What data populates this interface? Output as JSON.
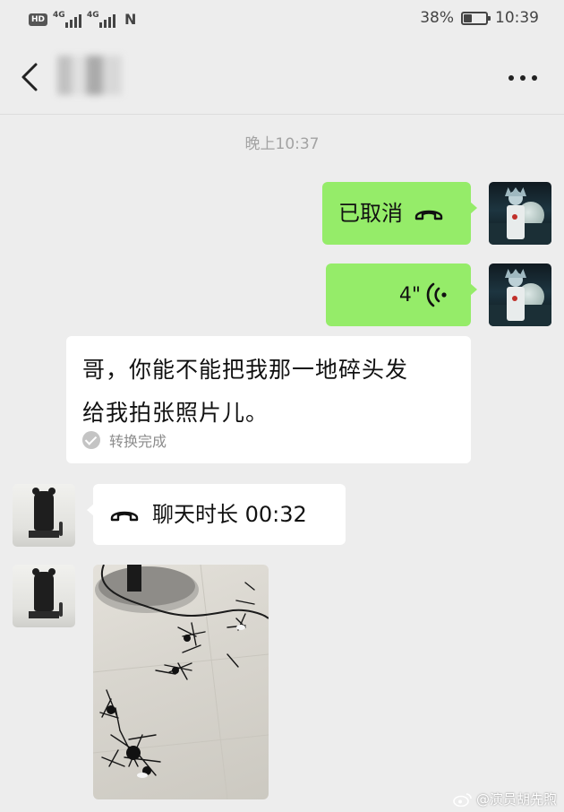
{
  "status_bar": {
    "hd_label": "HD",
    "network_1": "4G",
    "network_2": "4G",
    "nfc_label": "N",
    "battery_percent_text": "38%",
    "battery_level": 0.38,
    "time": "10:39"
  },
  "nav": {
    "back_icon": "chevron-left-icon",
    "more_icon": "more-dots-icon"
  },
  "chat": {
    "timestamp": "晚上10:37",
    "messages": [
      {
        "type": "call-cancelled",
        "direction": "out",
        "text": "已取消",
        "icon": "phone-hangup-icon"
      },
      {
        "type": "voice",
        "direction": "out",
        "duration": "4\"",
        "icon": "voice-wave-icon"
      },
      {
        "type": "voice-transcript",
        "direction": "in",
        "line1": "哥，你能不能把我那一地碎头发",
        "line2": "给我拍张照片儿。",
        "status": "转换完成"
      },
      {
        "type": "call-duration",
        "direction": "in",
        "text": "聊天时长 00:32",
        "icon": "phone-hangup-icon"
      },
      {
        "type": "image",
        "direction": "in",
        "description_icon": "photo-icon"
      }
    ]
  },
  "watermark": {
    "text": "@演员胡先煦",
    "icon": "weibo-icon"
  },
  "colors": {
    "background": "#ededed",
    "outgoing_bubble": "#95ec69",
    "incoming_bubble": "#ffffff",
    "timestamp": "#a3a3a3"
  }
}
